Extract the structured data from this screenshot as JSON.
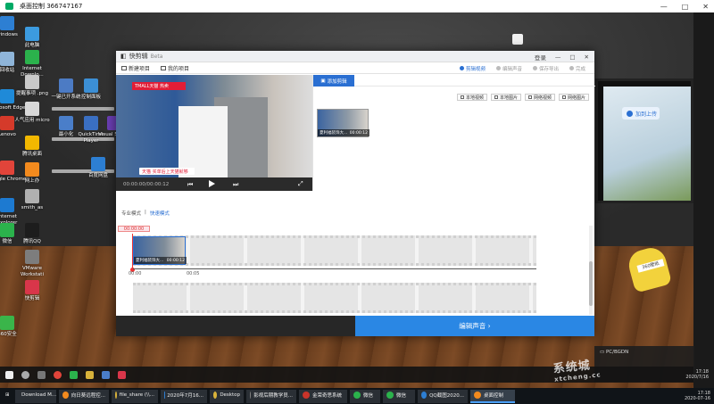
{
  "remote": {
    "title": "桌面控制 366747167",
    "controls": [
      "—",
      "□",
      "✕"
    ]
  },
  "desktop_icons": [
    {
      "label": "windows",
      "color": "#2d7fd3"
    },
    {
      "label": "此电脑",
      "color": "#3c9be0"
    },
    {
      "label": "Internet Downlo...",
      "color": "#2bb24c"
    },
    {
      "label": "回收站",
      "color": "#8fb5d9"
    },
    {
      "label": "提醒事项 .png",
      "color": "#c9c9c9"
    },
    {
      "label": "一键已开系统",
      "color": "#4c7bc4"
    },
    {
      "label": "控制面板",
      "color": "#3c8fd5"
    },
    {
      "label": "Microsoft Edge",
      "color": "#1f8ad8"
    },
    {
      "label": "人气应用 micro",
      "color": "#d8d8d8"
    },
    {
      "label": "最小化",
      "color": "#4a7ec9"
    },
    {
      "label": "QuickTime Player",
      "color": "#3a6fc2"
    },
    {
      "label": "Visual Studio",
      "color": "#6d3fb7"
    },
    {
      "label": "Lenovo",
      "color": "#d53a2a"
    },
    {
      "label": "腾讯桌面",
      "color": "#f2b800"
    },
    {
      "label": "Google Chrome",
      "color": "#e1443a"
    },
    {
      "label": "网上办",
      "color": "#f28a1e"
    },
    {
      "label": "百度网盘",
      "color": "#2d7fd3"
    },
    {
      "label": "Internet Explorer",
      "color": "#1d7ad1"
    },
    {
      "label": "smith_as",
      "color": "#b0b0b0"
    },
    {
      "label": "腾讯QQ",
      "color": "#1d1d1d"
    },
    {
      "label": "微信",
      "color": "#2bb24c"
    },
    {
      "label": "VMware Workstati",
      "color": "#7d7d7d"
    },
    {
      "label": "快剪辑",
      "color": "#d9364a"
    },
    {
      "label": "360安全",
      "color": "#3ab54a"
    }
  ],
  "desktop": {
    "float_button": "加到上传",
    "mascot_label": "360壁纸",
    "pc_name": "PC/BGDN"
  },
  "app": {
    "name": "快剪辑",
    "badge": "Beta",
    "window_controls": [
      "登录",
      "—",
      "□",
      "✕"
    ],
    "toolbar": {
      "new_project": "新建项目",
      "my_projects": "我的项目"
    },
    "steps": [
      {
        "label": "剪辑视频",
        "active": true
      },
      {
        "label": "编辑声音",
        "active": false
      },
      {
        "label": "保存导出",
        "active": false
      },
      {
        "label": "完成",
        "active": false
      }
    ],
    "preview": {
      "brand_tag": "TMALL天猫",
      "brand_text": "热卖",
      "caption": "天猫 买单后上天猫就够",
      "time": "00:00:00/00:00:12",
      "controls": {
        "prev": "⏮",
        "play": "▶",
        "next": "⏭",
        "fullscreen": "⤢"
      }
    },
    "media": {
      "tab": "添加剪辑",
      "import_buttons": [
        "本地视频",
        "本地图片",
        "网络视频",
        "网络图片"
      ],
      "clip": {
        "name": "夏利福装饰大...",
        "duration": "00:00:12"
      }
    },
    "timeline": {
      "modes": [
        "专业模式",
        "快速模式"
      ],
      "current_time": "00:00:00",
      "clip": {
        "name": "夏利福装饰大...",
        "duration": "00:00:12"
      },
      "ruler_labels": [
        "00:00",
        "00:05"
      ]
    },
    "footer": {
      "next_button": "编辑声音 ›"
    }
  },
  "inner_taskbar": {
    "icons": [
      "windows-start",
      "search",
      "task-view",
      "chrome",
      "wechat",
      "explorer",
      "store",
      "jianji"
    ],
    "time": "17:18",
    "date": "2020/7/16"
  },
  "outer_taskbar": {
    "items": [
      {
        "label": "Download M...",
        "color": "#3ab54a",
        "active": false
      },
      {
        "label": "向日葵远程控...",
        "color": "#f28a1e",
        "active": false
      },
      {
        "label": "file_share (\\\\...",
        "color": "#d8b23a",
        "active": false
      },
      {
        "label": "2020年7月16...",
        "color": "#2d7fd3",
        "active": false
      },
      {
        "label": "Desktop",
        "color": "#d8b23a",
        "active": false
      },
      {
        "label": "影视后期教学员...",
        "color": "#7d7d7d",
        "active": false
      },
      {
        "label": "金荣奇思系统",
        "color": "#c9342a",
        "active": false
      },
      {
        "label": "微信",
        "color": "#2bb24c",
        "active": false
      },
      {
        "label": "微信",
        "color": "#2bb24c",
        "active": false
      },
      {
        "label": "QQ截图2020...",
        "color": "#2d7fd3",
        "active": false
      },
      {
        "label": "桌面控制",
        "color": "#f28a1e",
        "active": true
      }
    ],
    "tray_time": "17:18",
    "tray_date": "2020-07-16"
  },
  "watermark": {
    "text": "系统城",
    "url": "xtcheng.cc"
  }
}
